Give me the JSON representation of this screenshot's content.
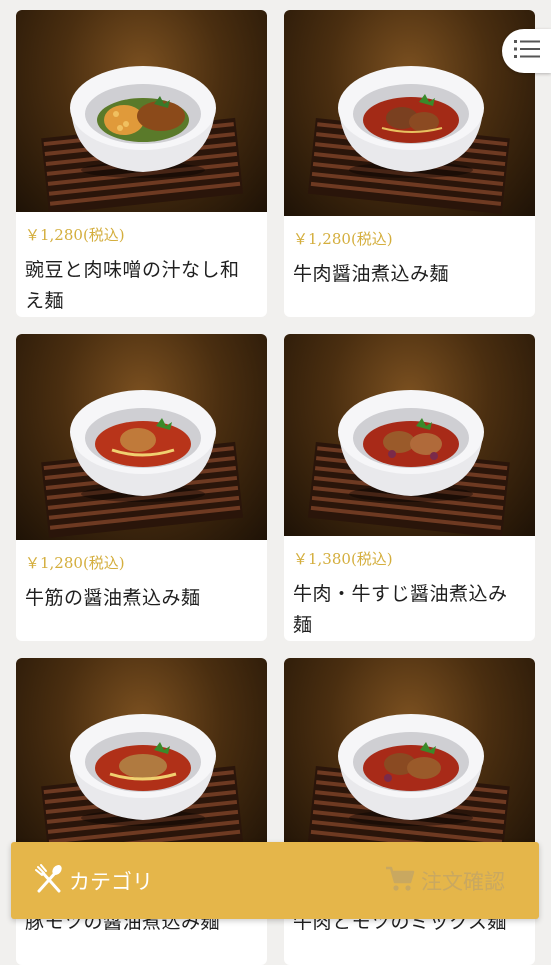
{
  "menu_items": [
    {
      "price": "￥1,280(税込)",
      "name": "豌豆と肉味噌の汁なし和え麺"
    },
    {
      "price": "￥1,280(税込)",
      "name": "牛肉醤油煮込み麺"
    },
    {
      "price": "￥1,280(税込)",
      "name": "牛筋の醤油煮込み麺"
    },
    {
      "price": "￥1,380(税込)",
      "name": "牛肉・牛すじ醤油煮込み麺"
    },
    {
      "price": "",
      "name": "豚モツの醤油煮込み麺"
    },
    {
      "price": "",
      "name": "牛肉とモツのミックス麺"
    }
  ],
  "bottom_bar": {
    "category_label": "カテゴリ",
    "order_label": "注文確認"
  },
  "icons": {
    "menu": "list-icon",
    "category": "fork-spoon-icon",
    "order": "cart-icon"
  },
  "colors": {
    "accent": "#e5b64a",
    "price": "#d4ae3d"
  }
}
